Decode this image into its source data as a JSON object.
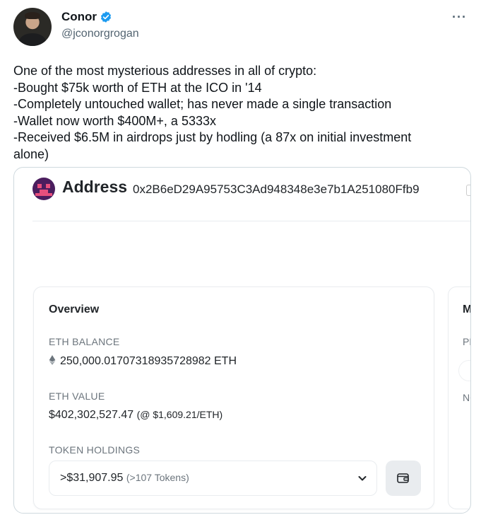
{
  "tweet": {
    "author_name": "Conor",
    "handle": "@jconorgrogan",
    "more_label": "···",
    "lines": [
      "One of the most mysterious addresses in all of crypto:",
      "-Bought $75k worth of ETH at the ICO in '14",
      "-Completely untouched wallet; has never made a single transaction",
      "-Wallet now worth $400M+, a 5333x",
      "-Received $6.5M in airdrops just by hodling (a 87x on initial investment",
      "alone)"
    ]
  },
  "card": {
    "title": "Address",
    "address": "0x2B6eD29A95753C3Ad948348e3e7b1A251080Ffb9",
    "overview": {
      "title": "Overview",
      "eth_balance_label": "ETH BALANCE",
      "eth_balance_value": "250,000.01707318935728982 ETH",
      "eth_value_label": "ETH VALUE",
      "eth_value": "$402,302,527.47",
      "eth_price_note": "(@ $1,609.21/ETH)",
      "token_holdings_label": "TOKEN HOLDINGS",
      "token_amount": ">$31,907.95",
      "token_count": "(>107 Tokens)"
    },
    "more_info": {
      "title": "M",
      "label_1": "PF",
      "label_2": "NC"
    }
  },
  "colors": {
    "verified": "#1d9bf0",
    "muted": "#536471",
    "card_border": "#cfd9de",
    "logo_bg": "#4b1d5e",
    "logo_accent": "#e84f7d"
  },
  "icons": [
    "verified-badge-icon",
    "more-icon",
    "copy-icon",
    "eth-diamond-icon",
    "chevron-down-icon",
    "wallet-icon"
  ]
}
